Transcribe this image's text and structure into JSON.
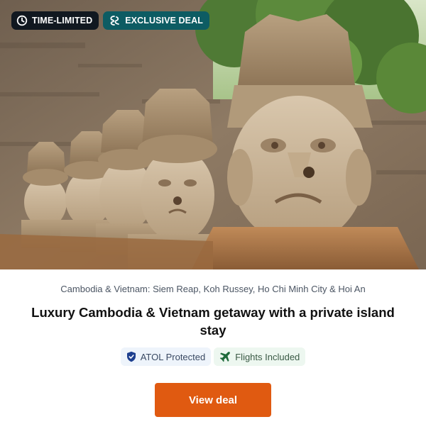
{
  "badges": {
    "time_limited": {
      "label": "TIME-LIMITED",
      "icon": "clock-icon"
    },
    "exclusive": {
      "label": "EXCLUSIVE DEAL",
      "icon": "secret-escapes-logo-icon"
    }
  },
  "hero": {
    "subject": "stone-guardian-heads-photo"
  },
  "deal": {
    "location": "Cambodia & Vietnam: Siem Reap, Koh Russey, Ho Chi Minh City & Hoi An",
    "title": "Luxury Cambodia & Vietnam getaway with a private island stay"
  },
  "tags": {
    "atol": {
      "label": "ATOL Protected",
      "icon": "shield-icon"
    },
    "flights": {
      "label": "Flights Included",
      "icon": "airplane-icon"
    }
  },
  "cta": {
    "label": "View deal"
  },
  "colors": {
    "time_badge_bg": "#111820",
    "exclusive_badge_bg": "#0d5c63",
    "cta_bg": "#e05a11",
    "atol_tag_bg": "#eef4fb",
    "flights_tag_bg": "#edf7f0"
  }
}
